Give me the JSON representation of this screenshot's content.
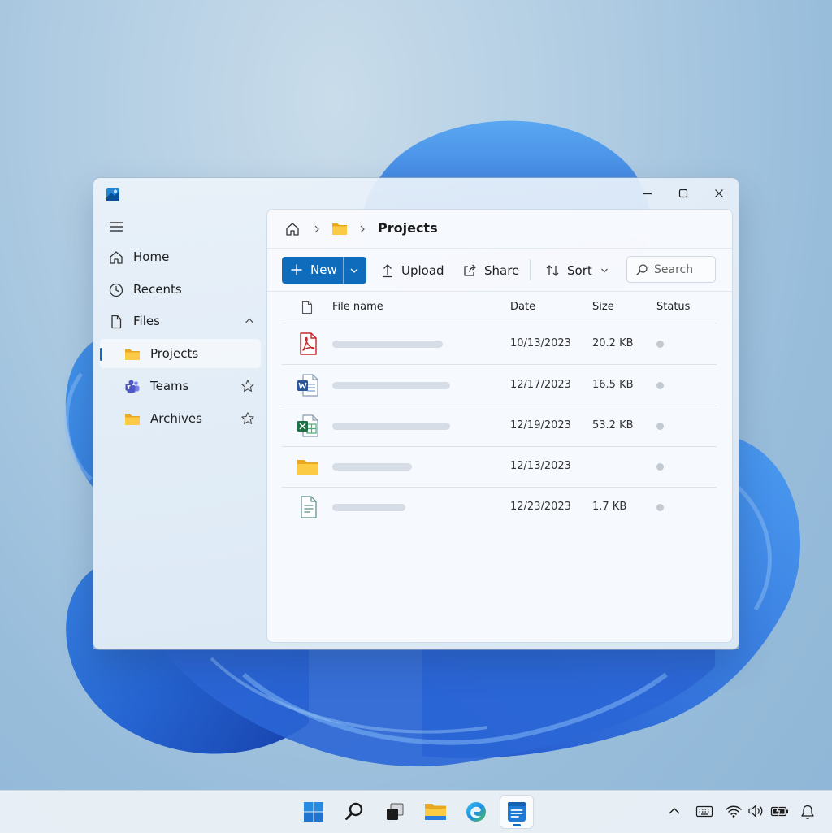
{
  "window": {
    "breadcrumb": {
      "current": "Projects"
    },
    "controls": {
      "minimize": "minimize",
      "maximize": "maximize",
      "close": "close"
    }
  },
  "sidebar": {
    "items": [
      {
        "label": "Home",
        "icon": "home-icon"
      },
      {
        "label": "Recents",
        "icon": "clock-icon"
      },
      {
        "label": "Files",
        "icon": "document-icon",
        "expanded": true
      },
      {
        "label": "Projects",
        "icon": "folder-icon",
        "selected": true
      },
      {
        "label": "Teams",
        "icon": "teams-icon",
        "favorite": false
      },
      {
        "label": "Archives",
        "icon": "folder-icon",
        "favorite": false
      }
    ]
  },
  "toolbar": {
    "new_label": "New",
    "upload_label": "Upload",
    "share_label": "Share",
    "sort_label": "Sort",
    "search_placeholder": "Search"
  },
  "table": {
    "columns": {
      "name": "File name",
      "date": "Date",
      "size": "Size",
      "status": "Status"
    },
    "rows": [
      {
        "type": "pdf",
        "icon": "pdf-file-icon",
        "date": "10/13/2023",
        "size": "20.2 KB"
      },
      {
        "type": "word",
        "icon": "word-file-icon",
        "date": "12/17/2023",
        "size": "16.5 KB"
      },
      {
        "type": "excel",
        "icon": "excel-file-icon",
        "date": "12/19/2023",
        "size": "53.2 KB"
      },
      {
        "type": "folder",
        "icon": "folder-icon",
        "date": "12/13/2023",
        "size": ""
      },
      {
        "type": "text",
        "icon": "text-file-icon",
        "date": "12/23/2023",
        "size": "1.7 KB"
      }
    ]
  },
  "taskbar": {
    "apps": [
      "start-icon",
      "search-icon",
      "task-view-icon",
      "file-explorer-icon",
      "edge-icon",
      "notepad-icon"
    ],
    "active_app": "notepad-icon",
    "tray": [
      "chevron-up-icon",
      "keyboard-icon",
      "wifi-icon",
      "volume-icon",
      "battery-icon",
      "bell-icon"
    ]
  },
  "colors": {
    "accent": "#0f6cbd",
    "folder": "#f8c33a",
    "pdf": "#c4282b",
    "word": "#2b579a",
    "excel": "#1d7145"
  }
}
